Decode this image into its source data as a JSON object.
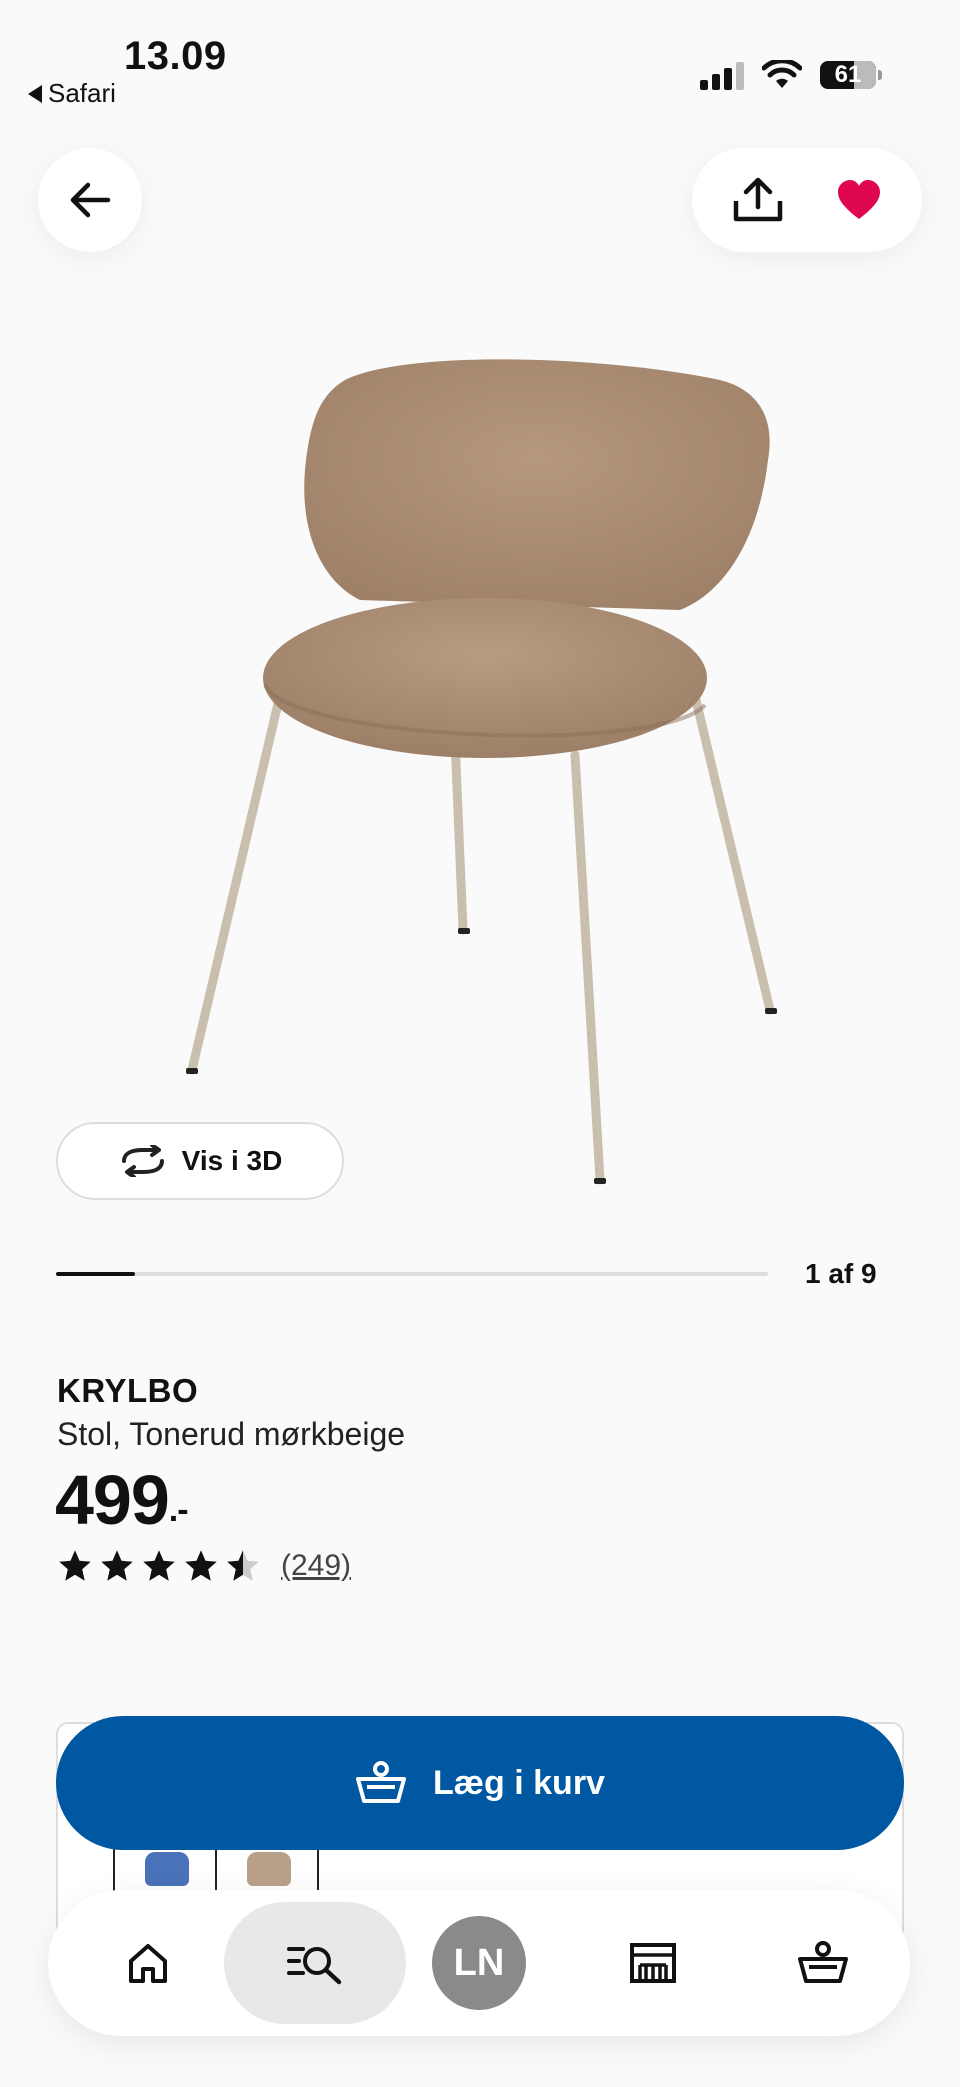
{
  "status_bar": {
    "time": "13.09",
    "back_app": "Safari",
    "battery": "61",
    "battery_fraction": 0.61
  },
  "top_actions": {
    "back_icon": "arrow-left-icon",
    "share_icon": "share-upload-icon",
    "favorite_icon": "heart-filled-icon",
    "favorite_color": "#e00751"
  },
  "gallery": {
    "view_3d_label": "Vis i 3D",
    "counter": "1 af 9",
    "current": 1,
    "total": 9
  },
  "product": {
    "name": "KRYLBO",
    "description": "Stol, Tonerud mørkbeige",
    "price": "499",
    "price_suffix": ".-",
    "rating_value": 4.5,
    "rating_max": 5,
    "review_count": "(249)"
  },
  "variants": [
    {
      "name": "blue",
      "color": "#4a72b8"
    },
    {
      "name": "beige",
      "color": "#b9a089"
    }
  ],
  "cart": {
    "add_label": "Læg i kurv",
    "button_color": "#0058a3"
  },
  "bottom_nav": {
    "avatar_initials": "LN",
    "items": [
      "home-icon",
      "search-list-icon",
      "profile-avatar",
      "store-icon",
      "basket-icon"
    ]
  }
}
